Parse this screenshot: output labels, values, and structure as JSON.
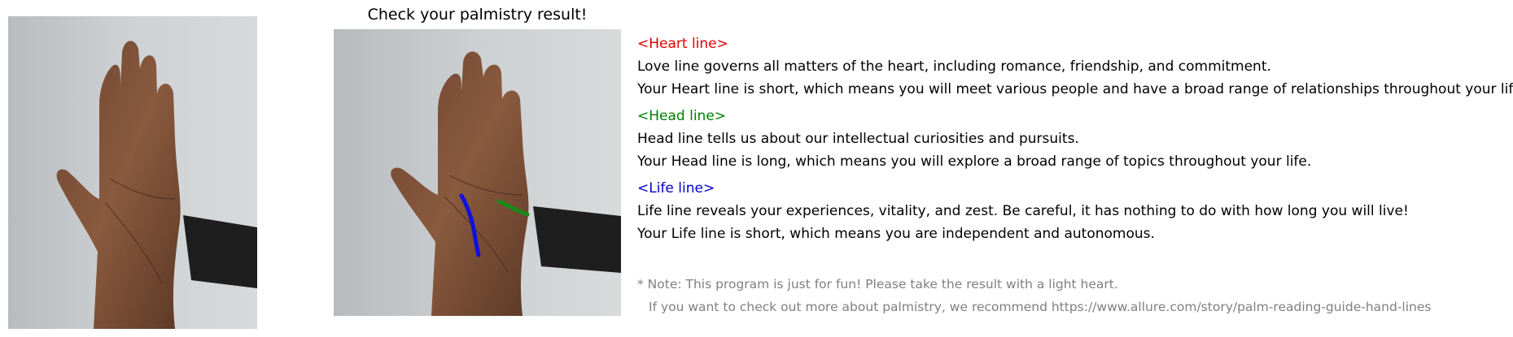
{
  "result_title": "Check your palmistry result!",
  "heart": {
    "heading": "<Heart line>",
    "description": "Love line governs all matters of the heart, including romance, friendship, and commitment.",
    "result": "Your Heart line is short, which means you will meet various people and have a broad range of relationships throughout your life.",
    "color": "#e00000"
  },
  "head": {
    "heading": "<Head line>",
    "description": "Head line tells us about our intellectual curiosities and pursuits.",
    "result": "Your Head line is long, which means you will explore a broad range of topics throughout your life.",
    "color": "#008000"
  },
  "life": {
    "heading": "<Life line>",
    "description": "Life line reveals your experiences, vitality, and zest. Be careful, it has nothing to do with how long you will live!",
    "result": "Your Life line is short, which means you are independent and autonomous.",
    "color": "#0000c8"
  },
  "note": {
    "line1": "* Note: This program is just for fun! Please take the result with a light heart.",
    "line2": "If you want to check out more about palmistry, we recommend https://www.allure.com/story/palm-reading-guide-hand-lines"
  }
}
